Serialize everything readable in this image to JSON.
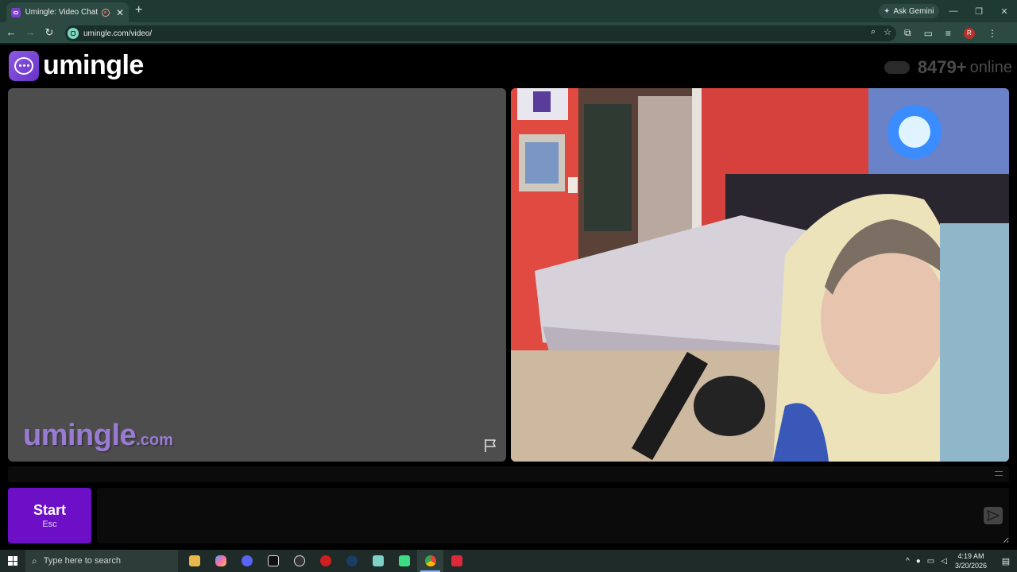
{
  "browser": {
    "tab_title": "Umingle: Video Chat with S",
    "tab_close": "✕",
    "new_tab": "+",
    "ask_gemini": "Ask Gemini",
    "url": "umingle.com/video/",
    "profile_initial": "R"
  },
  "header": {
    "logo_text": "umingle",
    "online_count": "8479+",
    "online_label": "online"
  },
  "stranger_panel": {
    "watermark_main": "umingle",
    "watermark_domain": ".com"
  },
  "controls": {
    "start_label": "Start",
    "start_shortcut": "Esc",
    "chat_placeholder": ""
  },
  "taskbar": {
    "search_placeholder": "Type here to search",
    "time": "4:19 AM",
    "date": "3/20/2026",
    "apps": [
      "file-explorer",
      "copilot",
      "discord",
      "unity",
      "obs",
      "recorder",
      "steam",
      "notepad",
      "android",
      "chrome",
      "streamlabs"
    ]
  },
  "colors": {
    "brand_purple": "#6d0fc7",
    "panel_gray": "#4d4d4d",
    "chrome_green": "#2c4a42"
  }
}
